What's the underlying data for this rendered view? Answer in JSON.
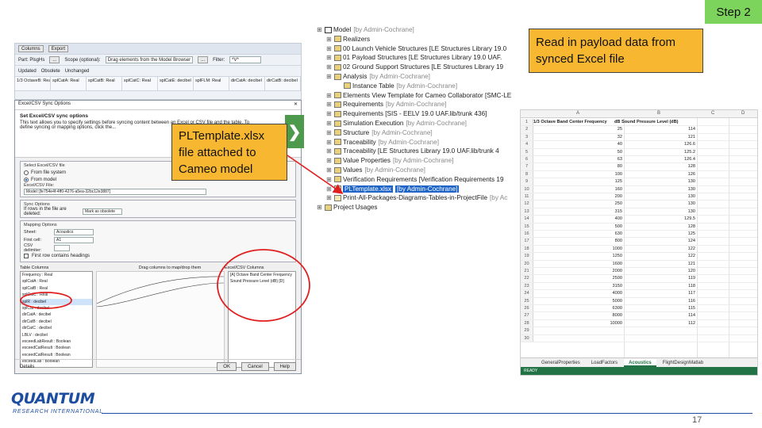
{
  "step": "Step 2",
  "callouts": {
    "right": "Read in payload data from synced Excel file",
    "left": "PLTemplate.xlsx file attached to Cameo model"
  },
  "browser": {
    "row1": [
      "Part: PlsgHs",
      "...",
      "Scope (optional):",
      "Drag elements from the Model Browser",
      "...",
      "Filter:",
      "*V*"
    ],
    "row2": [
      "Updated",
      "Obsolete",
      "Unchanged"
    ],
    "columns": [
      "1/3 OctaveB: Real",
      "splCatA: Real",
      "splCatB: Real",
      "splCatC: Real",
      "splCatD: Real",
      "splCatE: decibel",
      "splFLM: Real",
      "dirCatA: decibel",
      "dirCatB: decibel",
      "dirCatC: decibel"
    ],
    "toolbar": [
      "Columns",
      "Export"
    ]
  },
  "dialog": {
    "title": "Excel/CSV Sync Options",
    "heading": "Set Excel/CSV sync options",
    "desc": "This text allows you to specify settings before syncing content between an Excel or CSV file and the table. To define syncing or mapping options, click the...",
    "select_label": "Select Excel/CSV file",
    "from_fs": "From file system",
    "from_model": "From model",
    "file_label": "Excel/CSV File:",
    "file_value": "Model::[fe754e4f-4ff0-4276-a5ea-32bc12e3887]",
    "sync_label": "Sync Options",
    "sync_row": "If rows in the file are deleted:",
    "sync_value": "Mark as obsolete",
    "mapping_label": "Mapping Options",
    "sheet_label": "Sheet:",
    "sheet_value": "Acoustics",
    "first_cell_label": "First cell:",
    "first_cell_value": "A1",
    "csv_label": "CSV delimiter:",
    "first_row_label": "First row contains headings",
    "table_cols_label": "Table Columns",
    "map_caption": "Drag columns to map/drop them",
    "excel_cols_label": "Excel/CSV Columns",
    "table_columns": [
      "Frequency : Real",
      "splCatA : Real",
      "splCatB : Real",
      "splCatC : Real",
      "splR : decibel",
      "splCat : decibel",
      "dirCatA : decibel",
      "dirCatB : decibel",
      "dirCatC : decibel",
      "LBLV : decibel",
      "exceedLabResult : Boolean",
      "exceedCatResult : Boolean",
      "exceedCatResult : Boolean",
      "exceedLab : Boolean"
    ],
    "excel_columns": [
      "[A] Octave Band Center Frequency",
      "Sound Pressure Level (dB) [D]"
    ],
    "details": "Details",
    "ok": "OK",
    "cancel": "Cancel",
    "help": "Help"
  },
  "tree": {
    "items": [
      {
        "label": "Model",
        "owner": "[by Admin-Cochrane]",
        "depth": 0,
        "icon": "model"
      },
      {
        "label": "Realizers",
        "owner": "",
        "depth": 1,
        "icon": "pkg"
      },
      {
        "label": "00 Launch Vehicle Structures [LE Structures Library 19.0",
        "owner": "",
        "depth": 1,
        "icon": "pkg"
      },
      {
        "label": "01 Payload Structures [LE Structures Library 19.0 UAF.",
        "owner": "",
        "depth": 1,
        "icon": "pkg"
      },
      {
        "label": "02 Ground Support Structures [LE Structures Library 19",
        "owner": "",
        "depth": 1,
        "icon": "pkg"
      },
      {
        "label": "Analysis",
        "owner": "[by Admin-Cochrane]",
        "depth": 1,
        "icon": "pkg"
      },
      {
        "label": "Instance Table",
        "owner": "[by Admin-Cochrane]",
        "depth": 2,
        "icon": "pkg"
      },
      {
        "label": "Elements View Template for Cameo Collaborator [SMC-LE",
        "owner": "",
        "depth": 1,
        "icon": "pkg"
      },
      {
        "label": "Requirements",
        "owner": "[by Admin-Cochrane]",
        "depth": 1,
        "icon": "pkg"
      },
      {
        "label": "Requirements [SIS - EELV 19.0 UAF.lib/trunk 436]",
        "owner": "",
        "depth": 1,
        "icon": "pkg"
      },
      {
        "label": "Simulation Execution",
        "owner": "[by Admin-Cochrane]",
        "depth": 1,
        "icon": "pkg"
      },
      {
        "label": "Structure",
        "owner": "[by Admin-Cochrane]",
        "depth": 1,
        "icon": "pkg"
      },
      {
        "label": "Traceability",
        "owner": "[by Admin-Cochrane]",
        "depth": 1,
        "icon": "pkg"
      },
      {
        "label": "Traceability [LE Structures Library 19.0 UAF.lib/trunk 4",
        "owner": "",
        "depth": 1,
        "icon": "pkg"
      },
      {
        "label": "Value Properties",
        "owner": "[by Admin-Cochrane]",
        "depth": 1,
        "icon": "pkg"
      },
      {
        "label": "Values",
        "owner": "[by Admin-Cochrane]",
        "depth": 1,
        "icon": "pkg"
      },
      {
        "label": "Verification Requirements [Verification Requirements 19",
        "owner": "",
        "depth": 1,
        "icon": "pkg"
      },
      {
        "label": "PLTemplate.xlsx",
        "owner": "[by Admin-Cochrane]",
        "depth": 1,
        "icon": "file",
        "selected": true
      },
      {
        "label": "Print-All-Packages-Diagrams-Tables-in-ProjectFile",
        "owner": "[by Ac",
        "depth": 1,
        "icon": "file"
      },
      {
        "label": "Project Usages",
        "owner": "",
        "depth": 0,
        "icon": "pkg"
      }
    ]
  },
  "excel": {
    "col_letters": [
      "A",
      "B",
      "C",
      "D"
    ],
    "header_a": "1/3 Octave Band Center Frequency",
    "header_b": "dB Sound Pressure Level (dB)",
    "rows": [
      [
        "25",
        "114"
      ],
      [
        "32",
        "121"
      ],
      [
        "40",
        "126.6"
      ],
      [
        "50",
        "125.2"
      ],
      [
        "63",
        "126.4"
      ],
      [
        "80",
        "128"
      ],
      [
        "100",
        "126"
      ],
      [
        "125",
        "130"
      ],
      [
        "160",
        "130"
      ],
      [
        "200",
        "130"
      ],
      [
        "250",
        "130"
      ],
      [
        "315",
        "130"
      ],
      [
        "400",
        "129.5"
      ],
      [
        "500",
        "128"
      ],
      [
        "630",
        "125"
      ],
      [
        "800",
        "124"
      ],
      [
        "1000",
        "122"
      ],
      [
        "1250",
        "122"
      ],
      [
        "1600",
        "121"
      ],
      [
        "2000",
        "120"
      ],
      [
        "2500",
        "119"
      ],
      [
        "3150",
        "118"
      ],
      [
        "4000",
        "117"
      ],
      [
        "5000",
        "116"
      ],
      [
        "6300",
        "115"
      ],
      [
        "8000",
        "114"
      ],
      [
        "10000",
        "112"
      ]
    ],
    "extra_rows": [
      "29",
      "30"
    ],
    "tabs": [
      "GeneralProperties",
      "LoadFactors",
      "Acoustics",
      "FlightDesignMatlab"
    ],
    "active_tab": "Acoustics",
    "status": "READY"
  },
  "footer": {
    "logo_word": "QUANTUM",
    "logo_sub": "RESEARCH INTERNATIONAL",
    "page": "17"
  },
  "colors": {
    "callout": "#f7b731",
    "step_badge": "#7cd45c",
    "annotation": "#e02020",
    "brand_blue": "#1d4da1",
    "excel_green": "#217346"
  }
}
